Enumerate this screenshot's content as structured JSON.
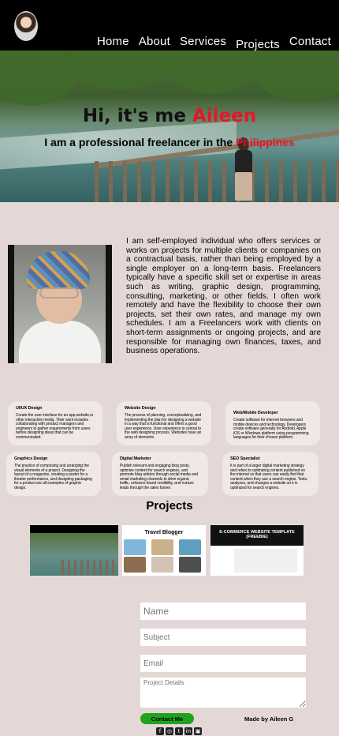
{
  "nav": {
    "links": [
      "Home",
      "About",
      "Services",
      "Projects",
      "Contact"
    ]
  },
  "hero": {
    "greeting": "Hi, it's me ",
    "name": "Aileen",
    "subtitle": "I am a professional freelancer in the ",
    "country": "Philippines"
  },
  "about": {
    "text": "I am self-employed individual who offers services or works on projects for multiple clients or companies on a contractual basis, rather than being employed by a single employer on a long-term basis. Freelancers typically have a specific skill set or expertise in areas such as writing, graphic design, programming, consulting, marketing, or other fields. I often work remotely and have the flexibility to choose their own projects, set their own rates, and manage my own schedules. I am a Freelancers work with clients on short-term assignments or ongoing projects, and are responsible for managing own finances, taxes, and business operations."
  },
  "services": [
    {
      "title": "UI/UX Design",
      "text": "Create the user interface for an app,website,or other interactive media. Their work includes collaborating with product managers and engineers to gather requirements from users before designing ideas that can be communicated."
    },
    {
      "title": "Website Design",
      "text": "The process of planning, conceptualizing, and implementing the plan for designing a website in a way that is functional and offers a good user experience. User experience is central to the web designing process. Websites have an array of elements."
    },
    {
      "title": "Web/Mobile Developer",
      "text": "Create software for internet browsers and mobile devices and technology. Developers create software generally for Android, Apple iOS or Windows platform using programming languages for their chosen platform."
    },
    {
      "title": "Graphics Design",
      "text": "The practice of composing and arranging the visual elements of a project. Designing the layout of a magazine, creating a poster for a theatre performance, and designing packaging for a product are all examples of graphic design."
    },
    {
      "title": "Digital Marketer",
      "text": "Publish relevant and engaging blog posts, optimize content for search engines, and promote blog articles through social media and email marketing channels to drive organic traffic, enhance brand credibility, and nurture leads through the sales funnel."
    },
    {
      "title": "SEO Specialist",
      "text": "It is part of a larger digital marketing strategy and refers to optimizing content published on the internet so that users can easily find that content when they use a search engine. Tests, analyzes, and changes a website so it is optimized for search engines."
    }
  ],
  "projects": {
    "title": "Projects",
    "travel_title": "Travel Blogger",
    "ecommerce_title": "E-COMMERCE WEBSITE TEMPLATE (FREEBIE)"
  },
  "contact": {
    "name_placeholder": "Name",
    "subject_placeholder": "Subject",
    "email_placeholder": "Email",
    "details_placeholder": "Project Details",
    "button": "Contact Me",
    "made_by": "Made by Aileen G"
  },
  "socials": [
    {
      "icon": "facebook-icon",
      "glyph": "f"
    },
    {
      "icon": "instagram-icon",
      "glyph": "◎"
    },
    {
      "icon": "twitter-icon",
      "glyph": "t"
    },
    {
      "icon": "linkedin-icon",
      "glyph": "in"
    },
    {
      "icon": "twitch-icon",
      "glyph": "▣"
    }
  ]
}
